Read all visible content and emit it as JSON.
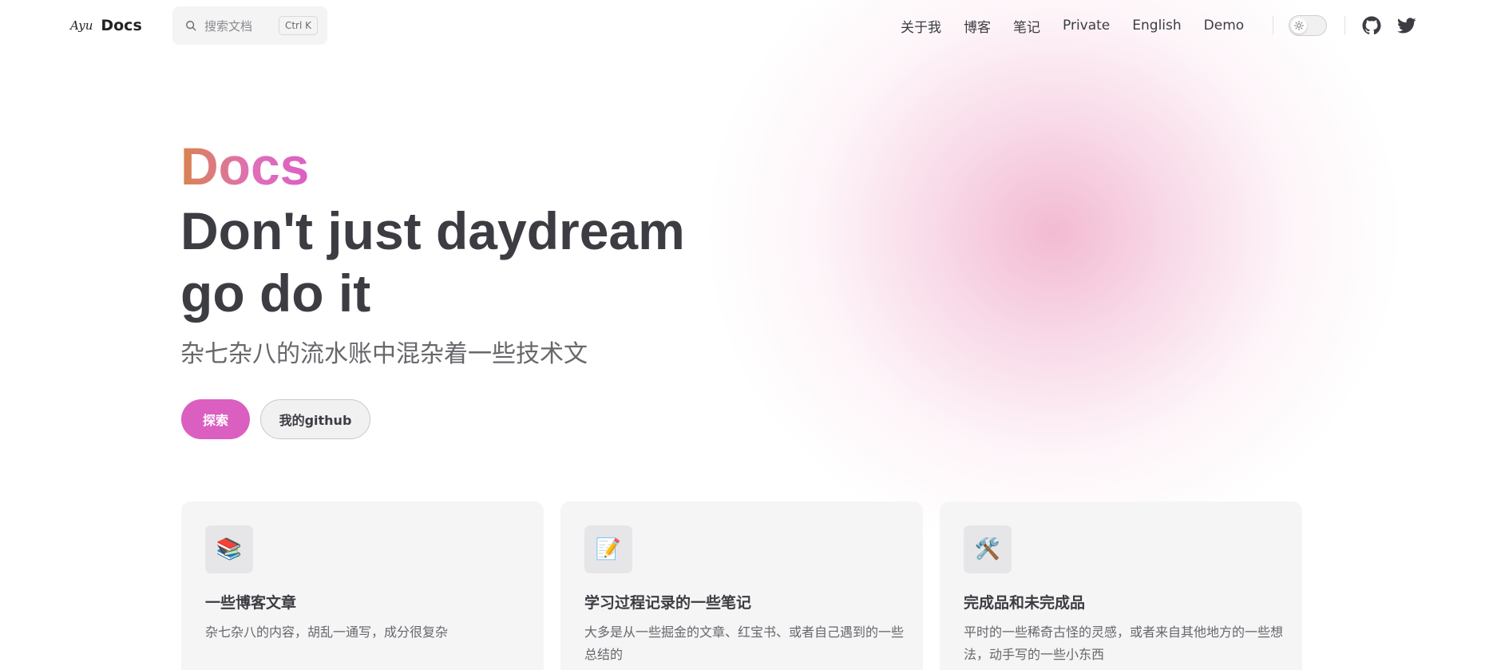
{
  "nav": {
    "logo_mark": "Ayu",
    "title": "Docs",
    "search_placeholder": "搜索文档",
    "search_shortcut": "Ctrl K",
    "links": [
      "关于我",
      "博客",
      "笔记",
      "Private",
      "English",
      "Demo"
    ],
    "theme_toggle": "light"
  },
  "hero": {
    "name": "Docs",
    "text_line1": "Don't just daydream",
    "text_line2": "go do it",
    "tagline": "杂七杂八的流水账中混杂着一些技术文",
    "actions": {
      "primary": "探索",
      "secondary": "我的github"
    }
  },
  "features": [
    {
      "icon": "books-icon",
      "emoji": "📚",
      "title": "一些博客文章",
      "desc": "杂七杂八的内容，胡乱一通写，成分很复杂"
    },
    {
      "icon": "memo-icon",
      "emoji": "📝",
      "title": "学习过程记录的一些笔记",
      "desc": "大多是从一些掘金的文章、红宝书、或者自己遇到的一些总结的"
    },
    {
      "icon": "tools-icon",
      "emoji": "🛠️",
      "title": "完成品和未完成品",
      "desc": "平时的一些稀奇古怪的灵感，或者来自其他地方的一些想法，动手写的一些小东西"
    }
  ],
  "colors": {
    "brand": "#db5fc1",
    "text": "#3c3c43",
    "muted": "#67676c"
  }
}
